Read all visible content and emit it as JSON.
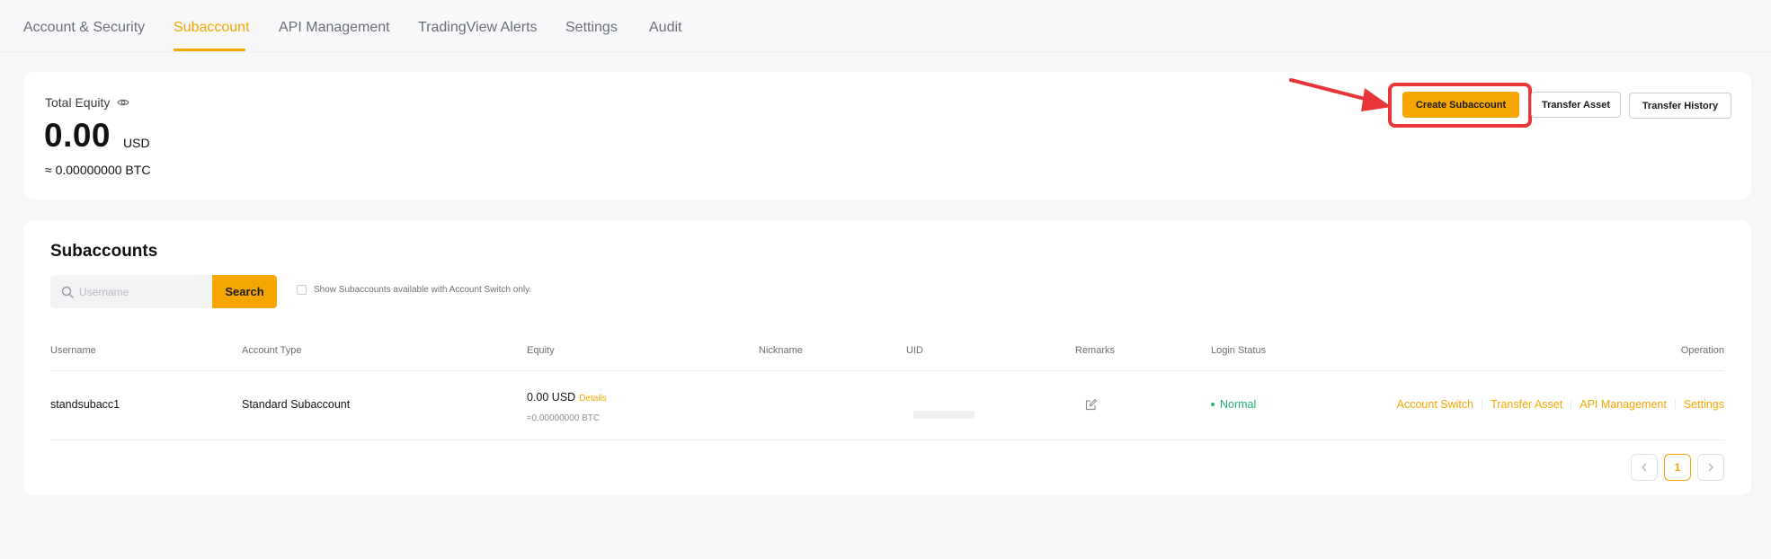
{
  "tabs": [
    {
      "label": "Account & Security"
    },
    {
      "label": "Subaccount"
    },
    {
      "label": "API Management"
    },
    {
      "label": "TradingView Alerts"
    },
    {
      "label": "Settings"
    },
    {
      "label": "Audit"
    }
  ],
  "active_tab": "Subaccount",
  "summary": {
    "equity_label": "Total Equity",
    "equity_value": "0.00",
    "equity_unit": "USD",
    "equity_btc": "≈ 0.00000000 BTC",
    "create_button": "Create Subaccount",
    "transfer_button": "Transfer Asset",
    "history_button": "Transfer History"
  },
  "subaccounts": {
    "title": "Subaccounts",
    "search_placeholder": "Username",
    "search_button": "Search",
    "checkbox_label": "Show Subaccounts available with Account Switch only.",
    "columns": [
      "Username",
      "Account Type",
      "Equity",
      "Nickname",
      "UID",
      "Remarks",
      "Login Status",
      "Operation"
    ],
    "rows": [
      {
        "username": "standsubacc1",
        "account_type": "Standard Subaccount",
        "equity": "0.00 USD",
        "details": "Details",
        "equity_btc": "≈0.00000000 BTC",
        "nickname": "",
        "login_status": "Normal",
        "operations": [
          "Account Switch",
          "Transfer Asset",
          "API Management",
          "Settings"
        ]
      }
    ],
    "pagination": {
      "current": "1"
    }
  },
  "colors": {
    "accent": "#f5a600",
    "status_normal": "#20b26c",
    "annotation": "#e8353a"
  }
}
